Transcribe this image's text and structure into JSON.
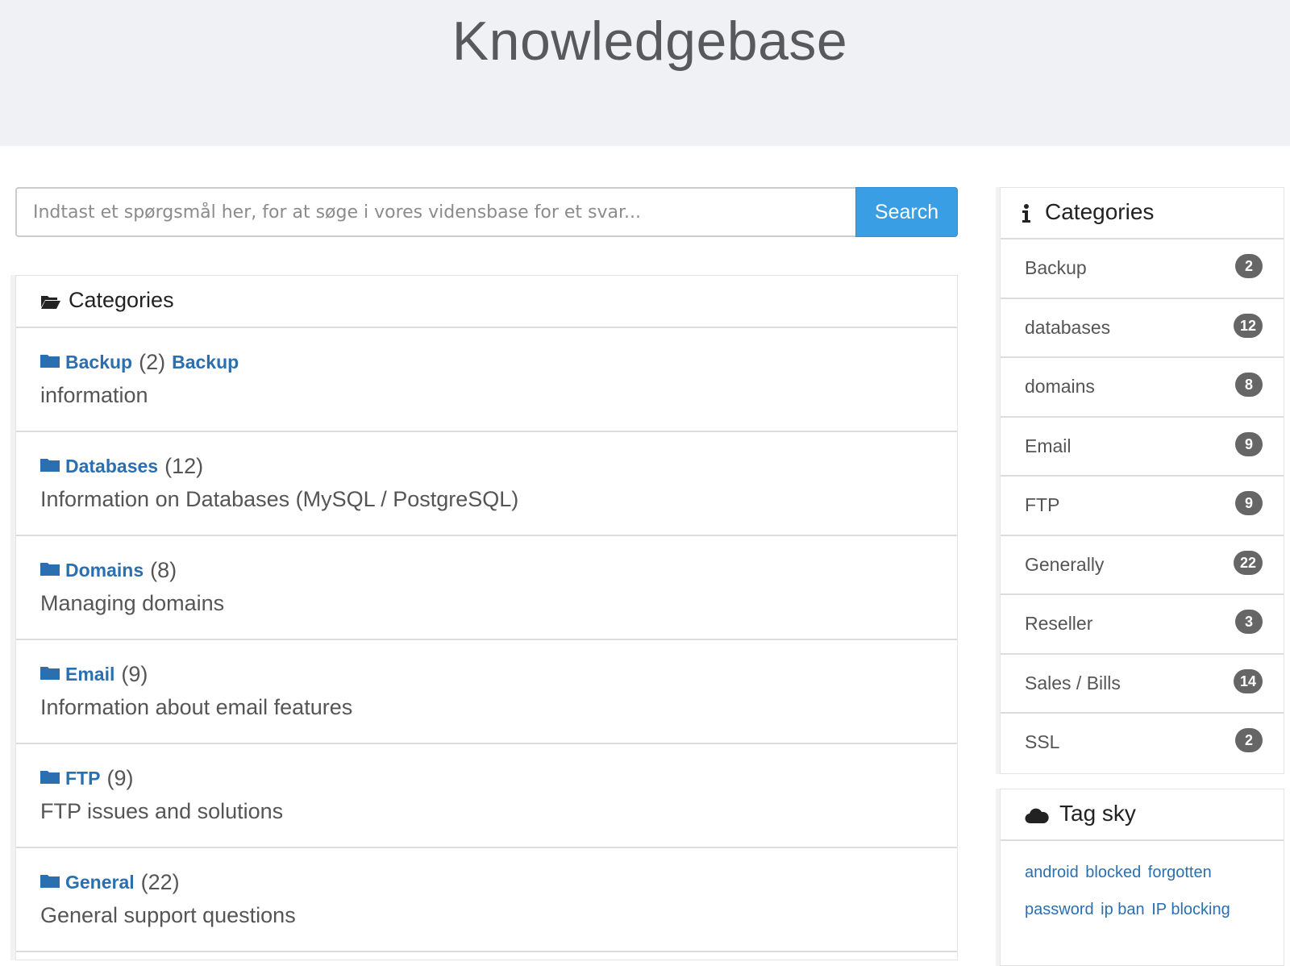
{
  "header": {
    "title": "Knowledgebase"
  },
  "search": {
    "placeholder": "Indtast et spørgsmål her, for at søge i vores vidensbase for et svar...",
    "button_label": "Search"
  },
  "categories_panel": {
    "title": "Categories",
    "icon": "folder-open-icon",
    "items": [
      {
        "name": "Backup",
        "count": "(2)",
        "extra": "Backup",
        "description": "information"
      },
      {
        "name": "Databases",
        "count": "(12)",
        "description": "Information on Databases (MySQL / PostgreSQL)"
      },
      {
        "name": "Domains",
        "count": "(8)",
        "description": "Managing domains"
      },
      {
        "name": "Email",
        "count": "(9)",
        "description": "Information about email features"
      },
      {
        "name": "FTP",
        "count": "(9)",
        "description": "FTP issues and solutions"
      },
      {
        "name": "General",
        "count": "(22)",
        "description": "General support questions"
      }
    ]
  },
  "sidebar_categories": {
    "title": "Categories",
    "icon": "info-icon",
    "items": [
      {
        "label": "Backup",
        "count": "2"
      },
      {
        "label": "databases",
        "count": "12"
      },
      {
        "label": "domains",
        "count": "8"
      },
      {
        "label": "Email",
        "count": "9"
      },
      {
        "label": "FTP",
        "count": "9"
      },
      {
        "label": "Generally",
        "count": "22"
      },
      {
        "label": "Reseller",
        "count": "3"
      },
      {
        "label": "Sales / Bills",
        "count": "14"
      },
      {
        "label": "SSL",
        "count": "2"
      }
    ]
  },
  "tag_sky": {
    "title": "Tag sky",
    "icon": "cloud-icon",
    "tags": [
      "android",
      "blocked",
      "forgotten",
      "password",
      "ip ban",
      "IP blocking"
    ]
  },
  "colors": {
    "accent": "#3a9ee4",
    "link": "#2a6fb0",
    "badge": "#666666",
    "header_bg": "#f0f1f5"
  }
}
